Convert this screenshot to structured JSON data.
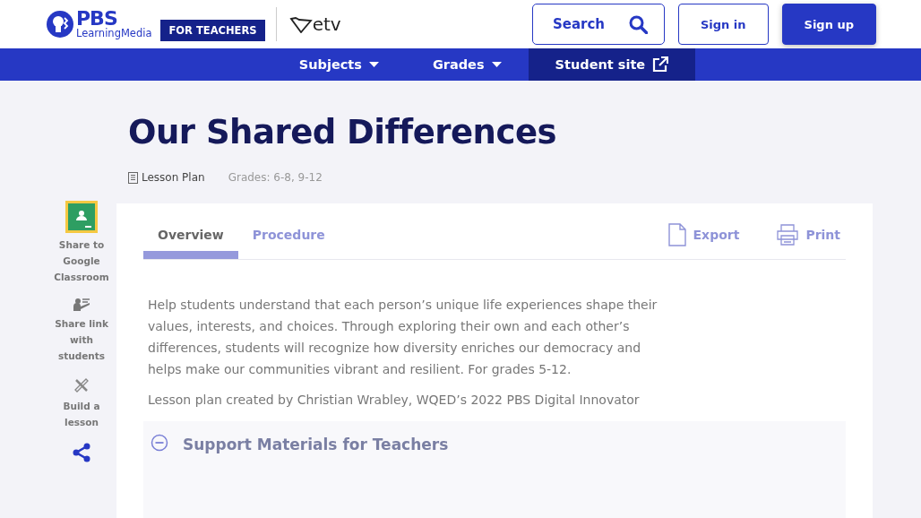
{
  "header": {
    "logo": {
      "name": "PBS",
      "sub": "LearningMedia"
    },
    "badge": "FOR TEACHERS",
    "partner": "etv",
    "search": {
      "placeholder": "Search"
    },
    "buttons": [
      {
        "label": "Sign in",
        "kind": "outline"
      },
      {
        "label": "Sign up",
        "kind": "filled"
      }
    ]
  },
  "nav": [
    {
      "label": "Subjects",
      "kind": "dropdown",
      "selected": false
    },
    {
      "label": "Grades",
      "kind": "dropdown",
      "selected": false
    },
    {
      "label": "Student site",
      "kind": "external",
      "selected": true
    }
  ],
  "title": "Our Shared Differences",
  "meta": {
    "type": "Lesson Plan",
    "grades": "Grades: 6-8, 9-12"
  },
  "sidebar": [
    {
      "label": "Share to Google Classroom",
      "kind": "classroom"
    },
    {
      "label": "Share link with students",
      "kind": "link"
    },
    {
      "label": "Build a lesson",
      "kind": "build"
    }
  ],
  "tabs": [
    {
      "label": "Overview",
      "selected": true
    },
    {
      "label": "Procedure",
      "selected": false
    }
  ],
  "actions": [
    {
      "label": "Export",
      "kind": "export"
    },
    {
      "label": "Print",
      "kind": "print"
    }
  ],
  "description": "Help students understand that each person’s unique life experiences shape their values, interests, and choices. Through exploring their own and each other’s differences, students will recognize how diversity enriches our democracy and helps make our communities vibrant and resilient. For grades 5-12.",
  "credit": "Lesson plan created by Christian Wrabley, WQED’s 2022 PBS Digital Innovator",
  "section": {
    "title": "Support Materials for Teachers",
    "expanded": true
  }
}
